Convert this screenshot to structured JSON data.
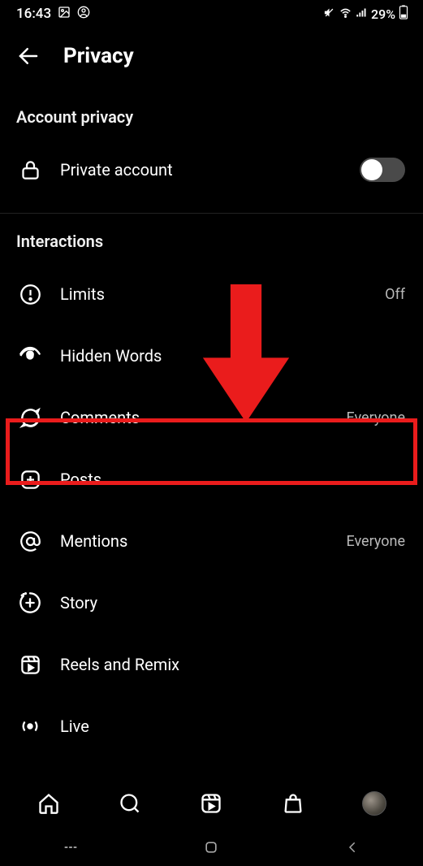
{
  "statusbar": {
    "time": "16:43",
    "battery_text": "29%"
  },
  "header": {
    "title": "Privacy"
  },
  "account_privacy": {
    "title": "Account privacy",
    "private_account_label": "Private account",
    "private_account_on": false
  },
  "interactions": {
    "title": "Interactions",
    "items": [
      {
        "label": "Limits",
        "value": "Off",
        "icon": "alert-circle-icon"
      },
      {
        "label": "Hidden Words",
        "value": "",
        "icon": "eye-hide-icon"
      },
      {
        "label": "Comments",
        "value": "Everyone",
        "icon": "comment-icon"
      },
      {
        "label": "Posts",
        "value": "",
        "icon": "plus-square-icon"
      },
      {
        "label": "Mentions",
        "value": "Everyone",
        "icon": "at-sign-icon"
      },
      {
        "label": "Story",
        "value": "",
        "icon": "story-add-icon"
      },
      {
        "label": "Reels and Remix",
        "value": "",
        "icon": "reels-icon"
      },
      {
        "label": "Live",
        "value": "",
        "icon": "live-icon"
      }
    ]
  },
  "annotation": {
    "highlighted_item": "Comments"
  }
}
